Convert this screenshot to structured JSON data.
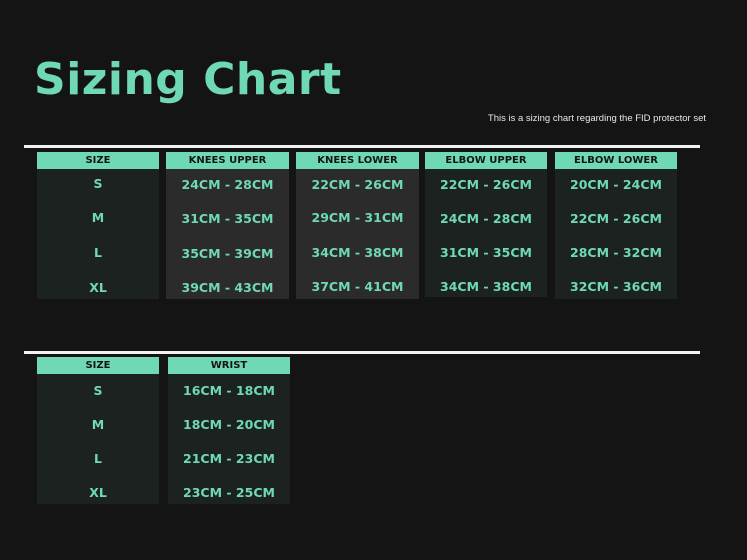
{
  "title": "Sizing Chart",
  "subtitle": "This is a sizing chart regarding the FID protector set",
  "colors": {
    "background": "#141414",
    "accent": "#6fd9b6",
    "divider": "#f2f2f2",
    "panel_dark": "#1b2220",
    "panel_gray": "#2b2b2b"
  },
  "table1": {
    "columns": [
      {
        "header": "SIZE",
        "values": [
          "S",
          "M",
          "L",
          "XL"
        ]
      },
      {
        "header": "KNEES UPPER",
        "values": [
          "24CM - 28CM",
          "31CM - 35CM",
          "35CM - 39CM",
          "39CM - 43CM"
        ]
      },
      {
        "header": "KNEES LOWER",
        "values": [
          "22CM - 26CM",
          "29CM - 31CM",
          "34CM - 38CM",
          "37CM - 41CM"
        ]
      },
      {
        "header": "ELBOW UPPER",
        "values": [
          "22CM - 26CM",
          "24CM - 28CM",
          "31CM - 35CM",
          "34CM - 38CM"
        ]
      },
      {
        "header": "ELBOW LOWER",
        "values": [
          "20CM - 24CM",
          "22CM - 26CM",
          "28CM - 32CM",
          "32CM - 36CM"
        ]
      }
    ]
  },
  "table2": {
    "columns": [
      {
        "header": "SIZE",
        "values": [
          "S",
          "M",
          "L",
          "XL"
        ]
      },
      {
        "header": "WRIST",
        "values": [
          "16CM - 18CM",
          "18CM - 20CM",
          "21CM - 23CM",
          "23CM - 25CM"
        ]
      }
    ]
  }
}
